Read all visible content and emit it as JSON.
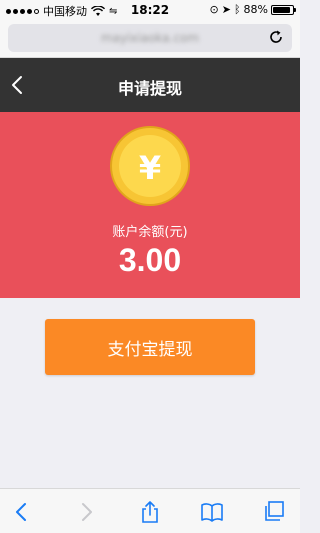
{
  "status_bar": {
    "carrier": "中国移动",
    "time": "18:22",
    "battery_text": "88%",
    "battery_level": 0.88
  },
  "browser": {
    "url": "mayixiaoka.com"
  },
  "header": {
    "title": "申请提现"
  },
  "balance": {
    "currency_symbol": "¥",
    "label": "账户余额(元)",
    "value": "3.00"
  },
  "actions": {
    "withdraw_label": "支付宝提现"
  },
  "colors": {
    "panel": "#e9505a",
    "button": "#fb8925",
    "navbar": "#333333",
    "toolbar_active": "#1a7cf5",
    "toolbar_disabled": "#c8c8cc"
  }
}
